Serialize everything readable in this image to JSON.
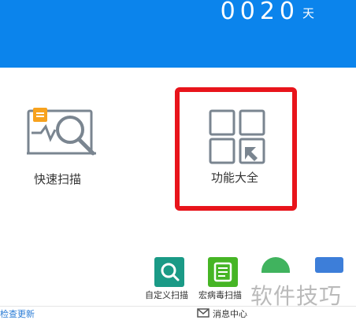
{
  "header": {
    "days_count": "0020",
    "days_unit": "天",
    "bg_color": "#0b84ec"
  },
  "tiles": {
    "quick_scan": {
      "label": "快速扫描",
      "icon": "magnifier-monitor-icon",
      "badge": "gift-badge-icon"
    },
    "function_all": {
      "label": "功能大全",
      "icon": "grid-arrow-icon",
      "highlight_color": "#e8141b"
    }
  },
  "tools": [
    {
      "label": "自定义扫描",
      "icon": "custom-scan-icon",
      "color": "#1a9a86"
    },
    {
      "label": "宏病毒扫描",
      "icon": "macro-virus-scan-icon",
      "color": "#46b525"
    },
    {
      "label": "",
      "icon": "tool-icon-green",
      "color": "#40b35e"
    },
    {
      "label": "",
      "icon": "tool-icon-blue",
      "color": "#3d7ed9"
    }
  ],
  "watermark": "软件技巧",
  "footer": {
    "update_link": "检查更新",
    "message_center": "消息中心"
  }
}
